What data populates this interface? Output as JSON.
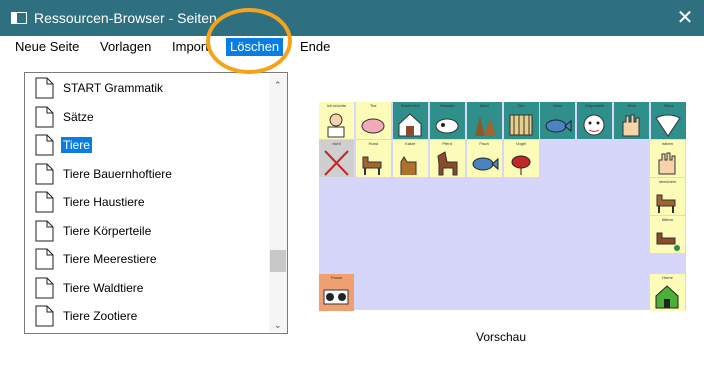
{
  "window": {
    "title": "Ressourcen-Browser - Seiten",
    "close_glyph": "✕"
  },
  "menu": [
    {
      "label": "Neue Seite",
      "active": false
    },
    {
      "label": "Vorlagen",
      "active": false
    },
    {
      "label": "Import",
      "active": false
    },
    {
      "label": "Löschen",
      "active": true
    },
    {
      "label": "Ende",
      "active": false
    }
  ],
  "pages": [
    {
      "label": "START Grammatik",
      "selected": false
    },
    {
      "label": "Sätze",
      "selected": false
    },
    {
      "label": "Tiere",
      "selected": true
    },
    {
      "label": "Tiere Bauernhoftiere",
      "selected": false
    },
    {
      "label": "Tiere Haustiere",
      "selected": false
    },
    {
      "label": "Tiere Körperteile",
      "selected": false
    },
    {
      "label": "Tiere Meerestiere",
      "selected": false
    },
    {
      "label": "Tiere Waldtiere",
      "selected": false
    },
    {
      "label": "Tiere Zootiere",
      "selected": false
    }
  ],
  "scrollbar": {
    "up_glyph": "⌃",
    "down_glyph": "⌄"
  },
  "preview": {
    "label": "Vorschau",
    "colors": {
      "background": "#d6d6fb",
      "yellow": "#fdfbb8",
      "teal": "#2e8f8b",
      "gray": "#cfcfcf",
      "orange": "#f0a070"
    },
    "tiles": [
      {
        "caption": "ich möchte",
        "icon": "person-icon",
        "color": "yellow"
      },
      {
        "caption": "Tier",
        "icon": "pig-icon",
        "color": "yellow"
      },
      {
        "caption": "Bauernhof",
        "icon": "farm-icon",
        "color": "teal"
      },
      {
        "caption": "Haustier",
        "icon": "pet-icon",
        "color": "teal"
      },
      {
        "caption": "Wald",
        "icon": "forest-icon",
        "color": "teal"
      },
      {
        "caption": "Zoo",
        "icon": "zoo-icon",
        "color": "teal"
      },
      {
        "caption": "Meer",
        "icon": "fish-icon",
        "color": "teal"
      },
      {
        "caption": "Körperteile",
        "icon": "face-icon",
        "color": "teal"
      },
      {
        "caption": "Wort",
        "icon": "hand-icon",
        "color": "teal"
      },
      {
        "caption": "Sätze",
        "icon": "fan-icon",
        "color": "teal"
      },
      {
        "caption": "nicht",
        "icon": "cross-icon",
        "color": "gray"
      },
      {
        "caption": "Hund",
        "icon": "dog-icon",
        "color": "yellow"
      },
      {
        "caption": "Katze",
        "icon": "cat-icon",
        "color": "yellow"
      },
      {
        "caption": "Pferd",
        "icon": "horse-icon",
        "color": "yellow"
      },
      {
        "caption": "Fisch",
        "icon": "fish-icon",
        "color": "yellow"
      },
      {
        "caption": "Vogel",
        "icon": "bird-icon",
        "color": "yellow"
      },
      {
        "caption": "haben",
        "icon": "hand-icon",
        "color": "yellow"
      },
      {
        "caption": "streicheln",
        "icon": "dog-icon",
        "color": "yellow"
      },
      {
        "caption": "füttern",
        "icon": "feed-icon",
        "color": "yellow"
      },
      {
        "caption": "Pause",
        "icon": "sign-icon",
        "color": "orange"
      },
      {
        "caption": "Home",
        "icon": "home-icon",
        "color": "yellow"
      }
    ]
  }
}
